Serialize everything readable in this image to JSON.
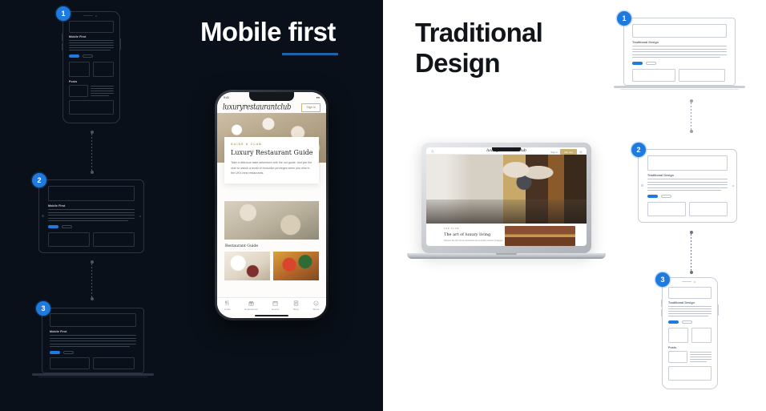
{
  "colors": {
    "dark_bg": "#0a1019",
    "light_bg": "#ffffff",
    "accent_blue": "#1f7ae0",
    "rule_blue": "#1d63a8",
    "gold": "#c8b072"
  },
  "left_panel": {
    "title": "Mobile first",
    "flow_steps": [
      {
        "badge": "1",
        "device": "phone",
        "screen_heading": "Mobile First",
        "section_heading": "Posts"
      },
      {
        "badge": "2",
        "device": "tablet",
        "screen_heading": "Mobile First"
      },
      {
        "badge": "3",
        "device": "laptop",
        "screen_heading": "Mobile First"
      }
    ]
  },
  "right_panel": {
    "title_line1": "Traditional",
    "title_line2": "Design",
    "flow_steps": [
      {
        "badge": "1",
        "device": "laptop",
        "screen_heading": "Traditional Design"
      },
      {
        "badge": "2",
        "device": "tablet",
        "screen_heading": "Traditional Design"
      },
      {
        "badge": "3",
        "device": "phone",
        "screen_heading": "Traditional Design",
        "section_heading": "Posts"
      }
    ]
  },
  "hero_phone": {
    "status_time": "9:41",
    "brand_logo": "luxuryrestaurantclub",
    "signin_label": "Sign in",
    "eyebrow": "GUIDE & CLUB",
    "card_title": "Luxury Restaurant Guide",
    "card_body": "Take a delicious taste adventure with the our guide, and join the club to unlock a world of exclusive privileges when you dine in the UK's best restaurants.",
    "section_title": "Restaurant Guide",
    "nav_items": [
      {
        "label": "Guide",
        "icon": "cutlery-icon"
      },
      {
        "label": "Experiences",
        "icon": "gift-icon"
      },
      {
        "label": "Events",
        "icon": "calendar-icon"
      },
      {
        "label": "Blog",
        "icon": "document-icon"
      },
      {
        "label": "About",
        "icon": "info-icon"
      }
    ]
  },
  "hero_laptop": {
    "brand_logo": "luxuryrestaurantclub",
    "search_icon": "search-icon",
    "nav_link": "Sign in",
    "cta_label": "Join now",
    "menu_icon": "menu-icon",
    "eyebrow": "THE CLUB",
    "title": "The art of luxury living",
    "subtitle": "Discover the UK's finest restaurants and exclusive member privileges."
  }
}
